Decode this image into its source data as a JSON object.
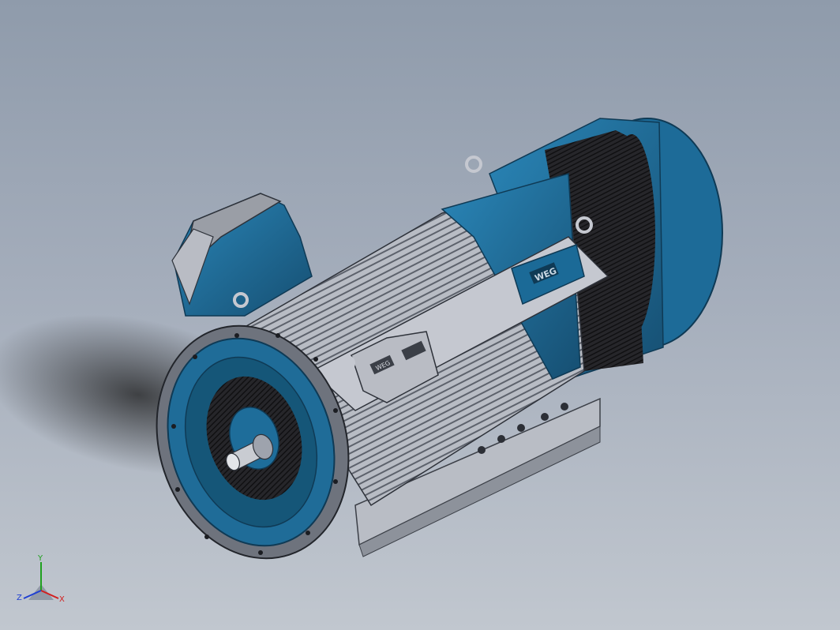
{
  "viewport": {
    "model": "electric-motor-assembly",
    "background_top": "#8f9bab",
    "background_bottom": "#c1c7cf"
  },
  "logos": {
    "nameplate_text": "WEG",
    "terminal_box_text": "WEG"
  },
  "triad": {
    "x_label": "X",
    "y_label": "Y",
    "z_label": "Z",
    "x_color": "#d21f1f",
    "y_color": "#1fa01f",
    "z_color": "#1f3fd2"
  },
  "colors": {
    "body_blue": "#1e6d9a",
    "fin_gray": "#a9adb5",
    "fan_dark": "#1c1c1f"
  }
}
